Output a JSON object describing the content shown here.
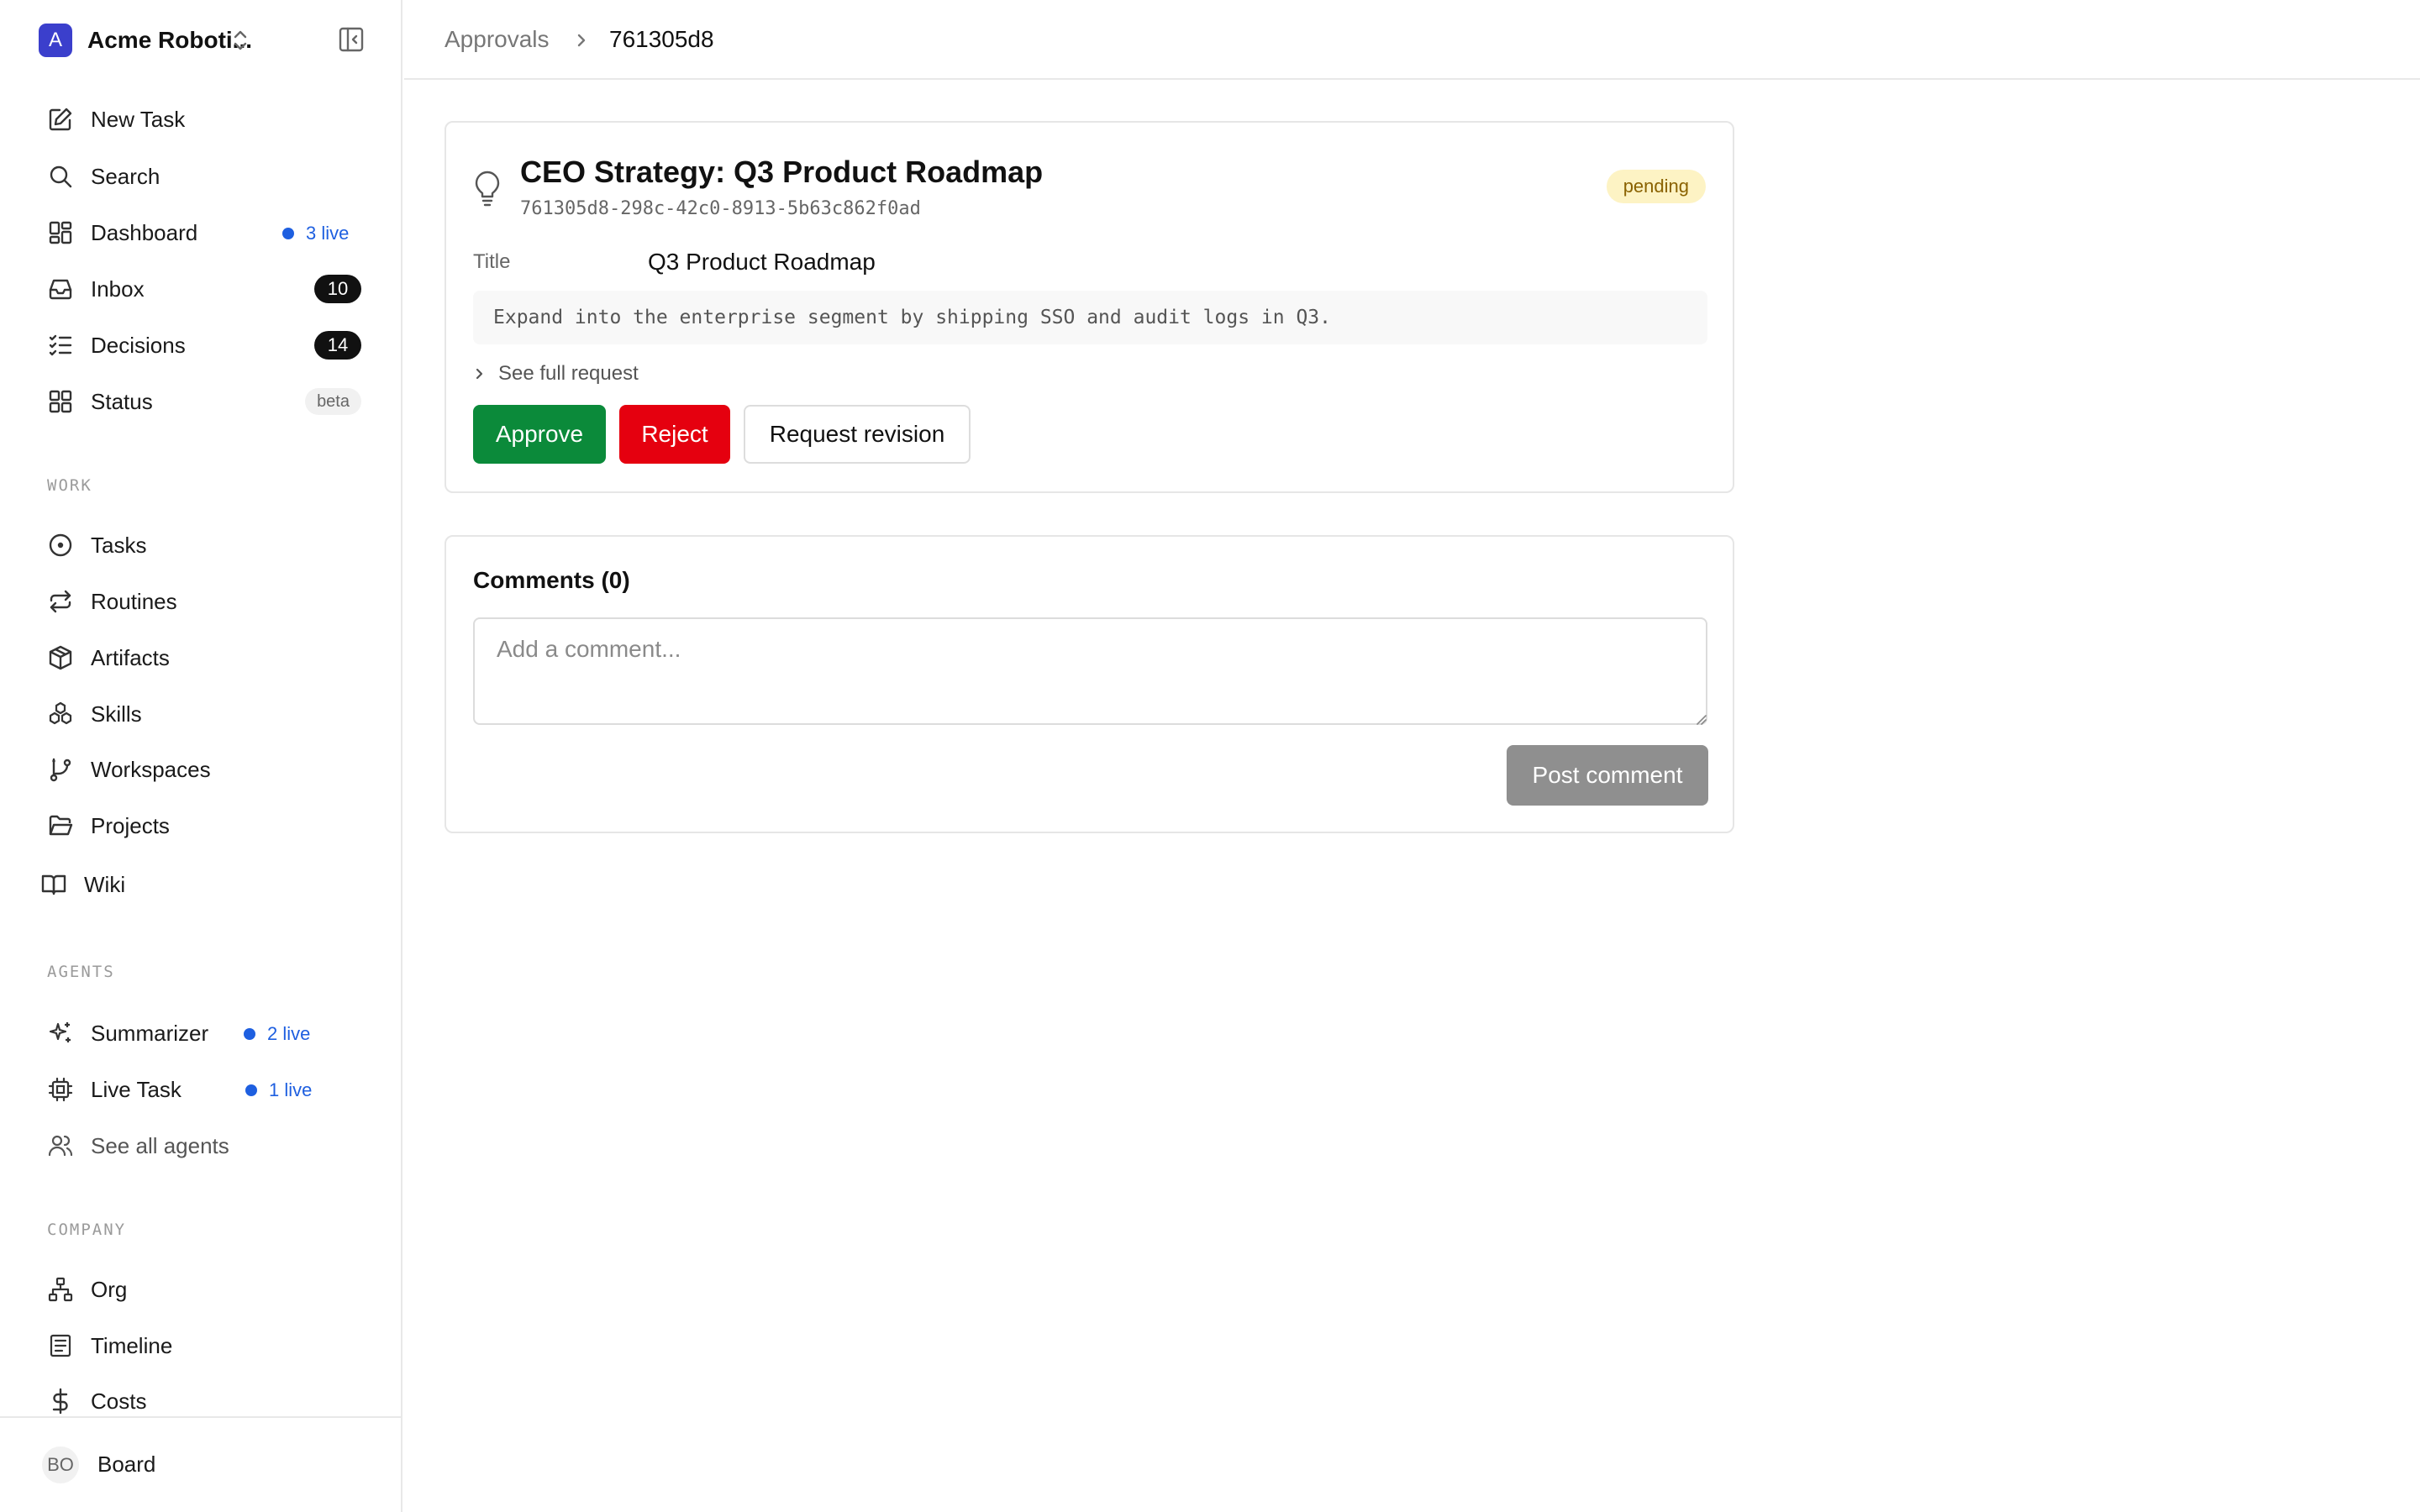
{
  "org": {
    "initial": "A",
    "name": "Acme Roboti..."
  },
  "nav": {
    "new_task": "New Task",
    "search": "Search",
    "dashboard": {
      "label": "Dashboard",
      "live": "3 live"
    },
    "inbox": {
      "label": "Inbox",
      "count": "10"
    },
    "decisions": {
      "label": "Decisions",
      "count": "14"
    },
    "status": {
      "label": "Status",
      "badge": "beta"
    }
  },
  "work": {
    "section": "WORK",
    "tasks": "Tasks",
    "routines": "Routines",
    "artifacts": "Artifacts",
    "skills": "Skills",
    "workspaces": "Workspaces",
    "projects": "Projects",
    "wiki": "Wiki"
  },
  "agents": {
    "section": "AGENTS",
    "summarizer": {
      "label": "Summarizer",
      "live": "2 live"
    },
    "live_task": {
      "label": "Live Task",
      "live": "1 live"
    },
    "see_all": "See all agents"
  },
  "company": {
    "section": "COMPANY",
    "org": "Org",
    "timeline": "Timeline",
    "costs": "Costs"
  },
  "footer": {
    "avatar": "BO",
    "label": "Board"
  },
  "breadcrumb": {
    "parent": "Approvals",
    "current": "761305d8"
  },
  "approval": {
    "title": "CEO Strategy: Q3 Product Roadmap",
    "id": "761305d8-298c-42c0-8913-5b63c862f0ad",
    "status": "pending",
    "field_label": "Title",
    "field_value": "Q3 Product Roadmap",
    "description": "Expand into the enterprise segment by shipping SSO and audit logs in Q3.",
    "expand_label": "See full request",
    "approve_label": "Approve",
    "reject_label": "Reject",
    "revision_label": "Request revision"
  },
  "comments": {
    "title": "Comments (0)",
    "placeholder": "Add a comment...",
    "value": "",
    "post_label": "Post comment"
  },
  "colors": {
    "approve": "#0b8a3a",
    "reject": "#e5000f",
    "live_blue": "#1e5fe0",
    "pending_bg": "#fdf3c4",
    "pending_text": "#8a6200"
  }
}
